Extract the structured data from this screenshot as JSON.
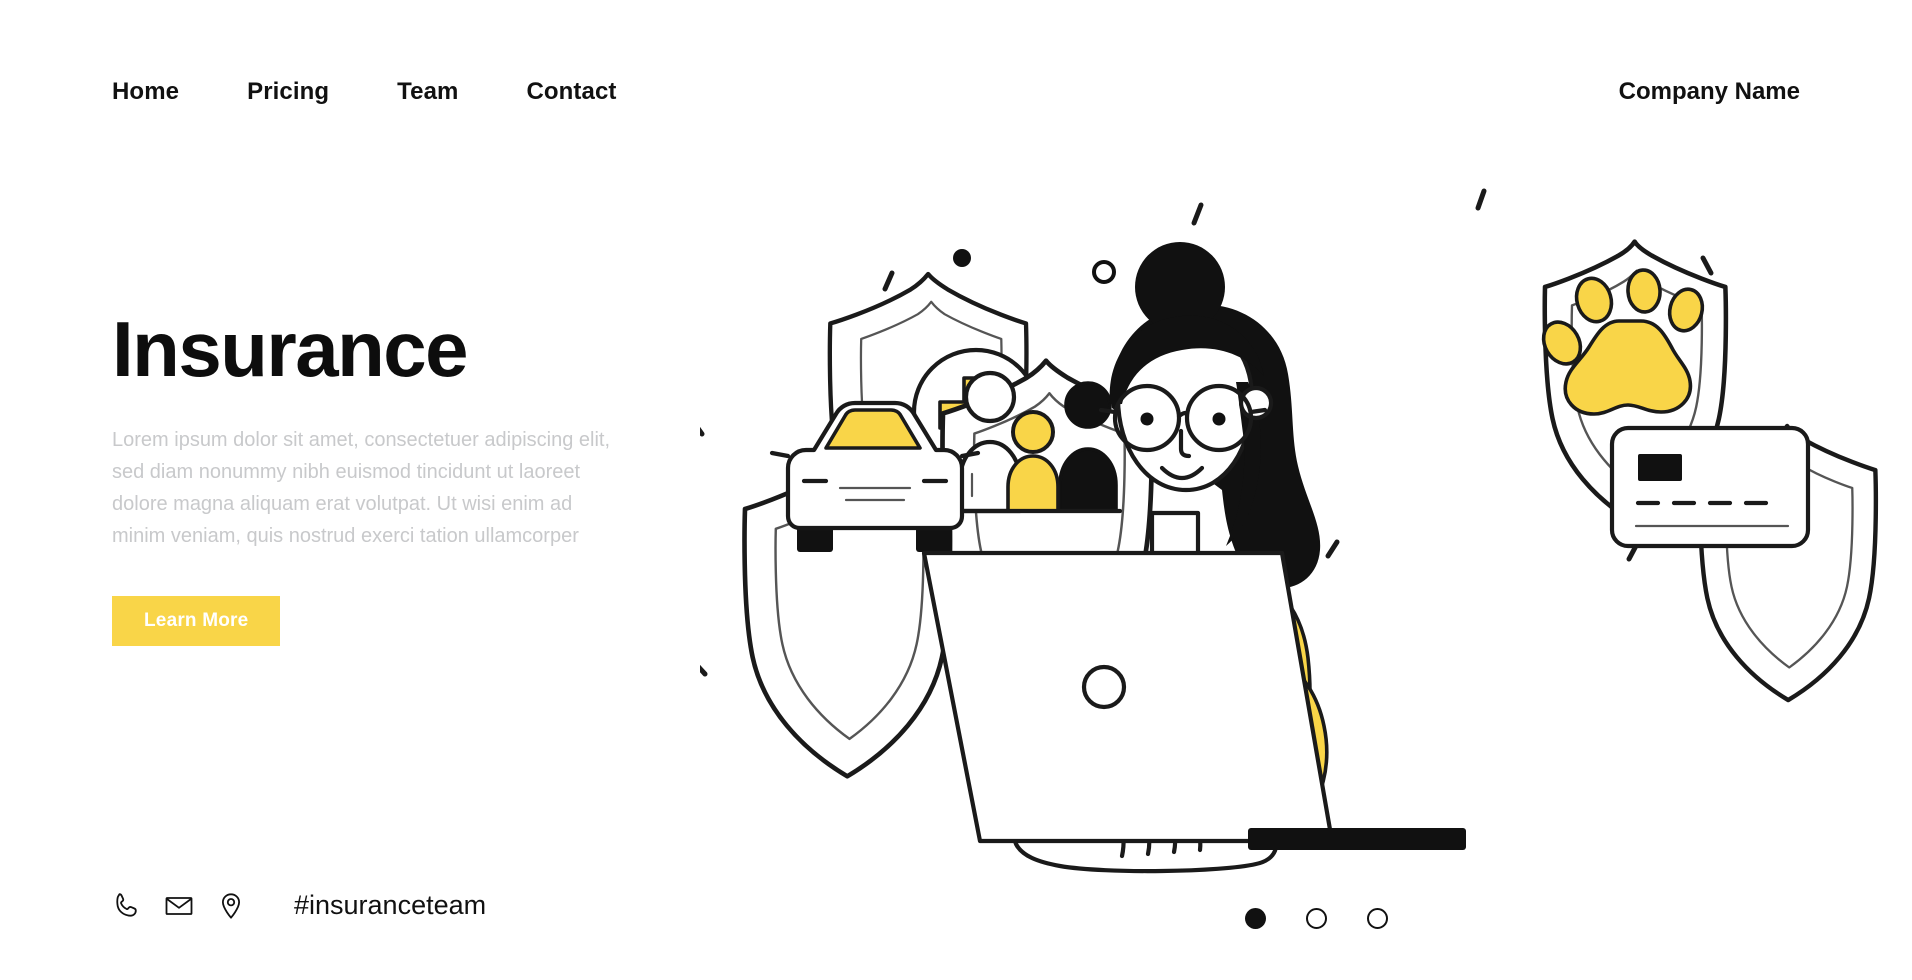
{
  "header": {
    "nav": [
      {
        "label": "Home",
        "name": "nav-link-home"
      },
      {
        "label": "Pricing",
        "name": "nav-link-pricing"
      },
      {
        "label": "Team",
        "name": "nav-link-team"
      },
      {
        "label": "Contact",
        "name": "nav-link-contact"
      }
    ],
    "brand": "Company Name"
  },
  "hero": {
    "title": "Insurance",
    "paragraph": "Lorem ipsum dolor sit amet, consectetuer adipiscing elit, sed diam nonummy nibh euismod tincidunt ut laoreet dolore magna aliquam erat volutpat. Ut wisi enim ad minim veniam, quis nostrud exerci tation ullamcorper",
    "cta_label": "Learn More"
  },
  "contact": {
    "icons": [
      "phone-icon",
      "envelope-icon",
      "location-pin-icon"
    ],
    "hashtag": "#insuranceteam"
  },
  "carousel": {
    "slides": [
      "1",
      "2",
      "3"
    ],
    "active_index": 0
  },
  "illustration": {
    "title": "insurance-hero-illustration",
    "shields": [
      {
        "name": "health-shield",
        "symbol": "medical-cross-icon"
      },
      {
        "name": "family-shield",
        "symbol": "family-group-icon"
      },
      {
        "name": "auto-shield",
        "symbol": "car-front-icon"
      },
      {
        "name": "pet-shield",
        "symbol": "paw-print-icon"
      },
      {
        "name": "payment-shield",
        "symbol": "credit-card-icon"
      }
    ],
    "character": "woman-with-laptop"
  },
  "colors": {
    "accent_yellow": "#f9d548",
    "accent_yellow_deep": "#f6c800",
    "ink": "#111111",
    "paragraph_gray": "#c8c9cb",
    "background": "#ffffff"
  }
}
